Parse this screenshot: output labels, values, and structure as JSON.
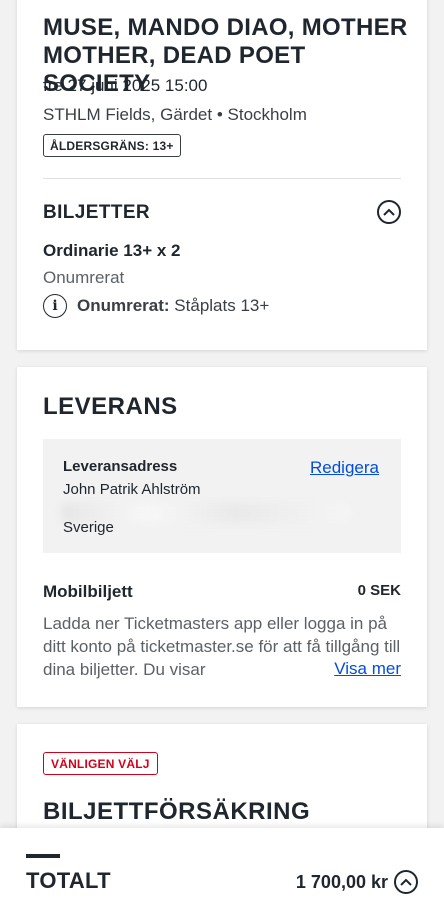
{
  "event": {
    "title": "MUSE, MANDO DIAO, MOTHER MOTHER, DEAD POET SOCIETY",
    "date": "fre 27 juni 2025 15:00",
    "venue": "STHLM Fields, Gärdet • Stockholm",
    "age_limit": "ÅLDERSGRÄNS: 13+"
  },
  "tickets": {
    "heading": "BILJETTER",
    "toggle_icon": "chevron-up-icon",
    "type": "Ordinarie 13+ x 2",
    "seating": "Onumrerat",
    "info_label": "Onumrerat:",
    "info_value": " Ståplats 13+"
  },
  "delivery": {
    "heading": "LEVERANS",
    "address_label": "Leveransadress",
    "edit_link": "Redigera",
    "name": "John Patrik Ahlström",
    "country": "Sverige",
    "mobile_label": "Mobilbiljett",
    "mobile_price": "0 SEK",
    "mobile_description": "Ladda ner Ticketmasters app eller logga in på ditt konto på ticketmaster.se för att få tillgång till dina biljetter. Du visar",
    "show_more": "Visa mer"
  },
  "insurance": {
    "badge": "VÄNLIGEN VÄLJ",
    "heading": "BILJETTFÖRSÄKRING"
  },
  "footer": {
    "total_label": "TOTALT",
    "total_value": "1 700,00 kr",
    "toggle_icon": "chevron-up-icon"
  },
  "colors": {
    "link": "#024ddf",
    "alert": "#d0021b",
    "text": "#1f262d"
  }
}
